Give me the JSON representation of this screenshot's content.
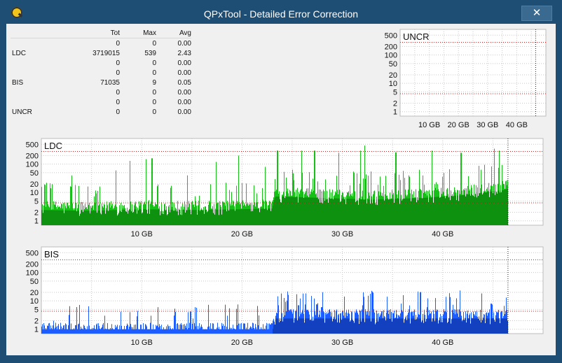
{
  "window": {
    "title": "QPxTool - Detailed Error Correction",
    "close_glyph": "✕",
    "icon": "qpxtool-app-icon"
  },
  "stats": {
    "headers": [
      "",
      "Tot",
      "Max",
      "Avg"
    ],
    "rows": [
      [
        "",
        "0",
        "0",
        "0.00"
      ],
      [
        "LDC",
        "3719015",
        "539",
        "2.43"
      ],
      [
        "",
        "0",
        "0",
        "0.00"
      ],
      [
        "",
        "0",
        "0",
        "0.00"
      ],
      [
        "BIS",
        "71035",
        "9",
        "0.05"
      ],
      [
        "",
        "0",
        "0",
        "0.00"
      ],
      [
        "",
        "0",
        "0",
        "0.00"
      ],
      [
        "UNCR",
        "0",
        "0",
        "0.00"
      ]
    ]
  },
  "colors": {
    "ldc_light": "#16c016",
    "ldc_dark": "#0a6a0a",
    "bis": "#1d5cff",
    "bis_dark": "#0b2a8a",
    "threshold": "#c02020",
    "grid": "#c8c8c8",
    "bg": "#ffffff"
  },
  "chart_data": [
    {
      "type": "bar",
      "label": "UNCR",
      "yscale": "log",
      "yticks": [
        "500",
        "200",
        "100",
        "50",
        "20",
        "10",
        "5",
        "2",
        "1"
      ],
      "xticks": [
        "10 GB",
        "20 GB",
        "30 GB",
        "40 GB"
      ],
      "xlim_gb": [
        0,
        50
      ],
      "disc_end_gb": 46.5,
      "thresholds": [
        280,
        4.3
      ],
      "series": [
        {
          "values": []
        }
      ]
    },
    {
      "type": "bar",
      "label": "LDC",
      "yscale": "log",
      "yticks": [
        "500",
        "200",
        "100",
        "50",
        "20",
        "10",
        "5",
        "2",
        "1"
      ],
      "xticks": [
        "10 GB",
        "20 GB",
        "30 GB",
        "40 GB"
      ],
      "xlim_gb": [
        0,
        50
      ],
      "disc_end_gb": 46.5,
      "thresholds": [
        280,
        4.3
      ],
      "typical_level": [
        [
          0,
          3
        ],
        [
          5,
          2.8
        ],
        [
          10,
          3.2
        ],
        [
          15,
          3
        ],
        [
          20,
          3.2
        ],
        [
          23,
          3.4
        ],
        [
          23.3,
          9
        ],
        [
          28,
          8
        ],
        [
          33,
          7
        ],
        [
          38,
          8
        ],
        [
          42,
          10
        ],
        [
          46,
          15
        ],
        [
          46.5,
          17
        ]
      ],
      "spike_peaks": [
        [
          0.5,
          22
        ],
        [
          3,
          40
        ],
        [
          7.4,
          60
        ],
        [
          8.8,
          130
        ],
        [
          10.4,
          150
        ],
        [
          11,
          160
        ],
        [
          14.5,
          40
        ],
        [
          17.4,
          120
        ],
        [
          19.6,
          200
        ],
        [
          22.3,
          80
        ],
        [
          23.5,
          300
        ],
        [
          25.9,
          300
        ],
        [
          27.2,
          300
        ],
        [
          29.6,
          250
        ],
        [
          31.8,
          300
        ],
        [
          32.2,
          450
        ],
        [
          35.3,
          260
        ],
        [
          38.9,
          300
        ],
        [
          41.8,
          250
        ],
        [
          45.1,
          350
        ],
        [
          45.6,
          300
        ]
      ],
      "series": [
        {
          "name": "LDC",
          "total": 3719015,
          "max": 539
        }
      ]
    },
    {
      "type": "bar",
      "label": "BIS",
      "yscale": "log",
      "yticks": [
        "500",
        "200",
        "100",
        "50",
        "20",
        "10",
        "5",
        "2",
        "1"
      ],
      "xticks": [
        "10 GB",
        "20 GB",
        "30 GB",
        "40 GB"
      ],
      "xlim_gb": [
        0,
        50
      ],
      "disc_end_gb": 46.5,
      "thresholds": [
        280,
        4.3
      ],
      "typical_level": [
        [
          0,
          1
        ],
        [
          23,
          1
        ],
        [
          23.3,
          3
        ],
        [
          46.5,
          3
        ]
      ],
      "spike_peaks": [
        [
          1.2,
          2
        ],
        [
          6.3,
          3
        ],
        [
          10.9,
          3
        ],
        [
          11.6,
          6
        ],
        [
          14.6,
          4
        ],
        [
          15.3,
          6
        ],
        [
          18.5,
          3
        ],
        [
          21.5,
          3
        ],
        [
          23.6,
          7
        ],
        [
          25.6,
          7
        ],
        [
          27.9,
          6
        ],
        [
          32,
          7
        ],
        [
          35.8,
          8
        ],
        [
          38.4,
          6
        ],
        [
          41.6,
          5
        ],
        [
          44.8,
          8
        ]
      ],
      "series": [
        {
          "name": "BIS",
          "total": 71035,
          "max": 9
        }
      ]
    }
  ]
}
